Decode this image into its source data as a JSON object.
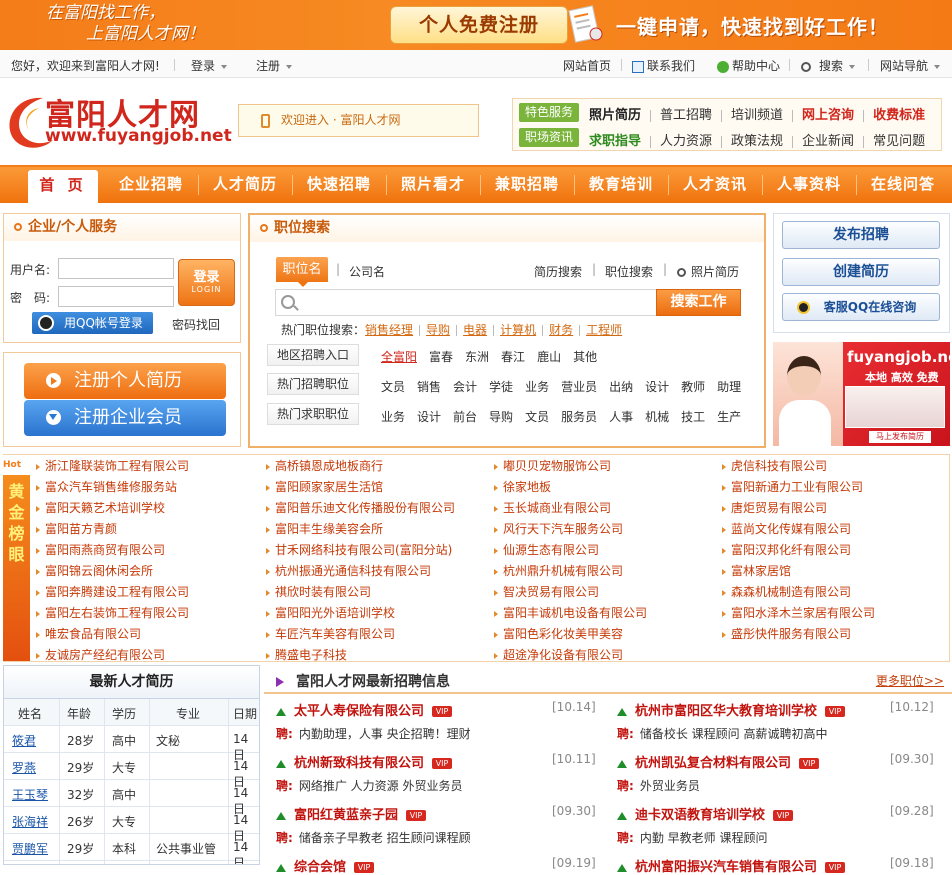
{
  "banner": {
    "slogan_line1": "在富阳找工作，",
    "slogan_line2": "上富阳人才网！",
    "register_label": "个人免费注册",
    "apply_text": "一键申请，快速找到好工作！"
  },
  "topbar": {
    "greeting": "您好，欢迎来到富阳人才网!",
    "login": "登录",
    "register": "注册",
    "site_home": "网站首页",
    "contact": "联系我们",
    "help": "帮助中心",
    "search": "搜索",
    "site_nav": "网站导航"
  },
  "header": {
    "logo_title": "富阳人才网",
    "logo_url": "www.fuyangjob.net",
    "welcome_text": "欢迎进入 · 富阳人才网",
    "quick_tags": [
      "特色服务",
      "职场资讯"
    ],
    "quick_row1": [
      "照片简历",
      "普工招聘",
      "培训频道",
      "网上咨询",
      "收费标准"
    ],
    "quick_row2": [
      "求职指导",
      "人力资源",
      "政策法规",
      "企业新闻",
      "常见问题"
    ]
  },
  "nav": {
    "items": [
      "首 页",
      "企业招聘",
      "人才简历",
      "快速招聘",
      "照片看才",
      "兼职招聘",
      "教育培训",
      "人才资讯",
      "人事资料",
      "在线问答"
    ]
  },
  "login": {
    "title": "企业/个人服务",
    "username_label": "用户名:",
    "password_label": "密　码:",
    "login_button": "登录",
    "login_button_en": "LOGIN",
    "qq_login": "用QQ帐号登录",
    "forgot": "密码找回",
    "register_person": "注册个人简历",
    "register_company": "注册企业会员"
  },
  "search": {
    "title": "职位搜索",
    "tab_active": "职位名",
    "tab_company": "公司名",
    "link_resume": "简历搜索",
    "link_job": "职位搜索",
    "link_photo": "照片简历",
    "input_placeholder": "",
    "button": "搜索工作",
    "hot_label": "热门职位搜索：",
    "hot_keywords": [
      "销售经理",
      "导购",
      "电器",
      "计算机",
      "财务",
      "工程师"
    ],
    "area_label": "地区招聘入口",
    "areas": [
      "全富阳",
      "富春",
      "东洲",
      "春江",
      "鹿山",
      "其他"
    ],
    "hot_jobs_label": "热门招聘职位",
    "hot_jobs": [
      "文员",
      "销售",
      "会计",
      "学徒",
      "业务",
      "营业员",
      "出纳",
      "设计",
      "教师",
      "助理"
    ],
    "hot_seek_label": "热门求职职位",
    "hot_seek": [
      "业务",
      "设计",
      "前台",
      "导购",
      "文员",
      "服务员",
      "人事",
      "机械",
      "技工",
      "生产"
    ]
  },
  "right": {
    "publish": "发布招聘",
    "create_resume": "创建简历",
    "qq_service": "客服QQ在线咨询",
    "ad_url": "fuyangjob.net",
    "ad_slogan": "本地 高效 免费",
    "ad_cta": "马上发布简历"
  },
  "gold": {
    "hot_tag": "Hot",
    "title": "黄金榜眼",
    "col1": [
      "浙江隆联装饰工程有限公司",
      "富众汽车销售维修服务站",
      "富阳天籁艺术培训学校",
      "富阳苗方青颜",
      "富阳雨燕商贸有限公司",
      "富阳锦云阁休闲会所",
      "富阳奔腾建设工程有限公司",
      "富阳左右装饰工程有限公司",
      "唯宏食品有限公司",
      "友诚房产经纪有限公司"
    ],
    "col2": [
      "高桥镇恩成地板商行",
      "富阳顾家家居生活馆",
      "富阳普乐迪文化传播股份有限公司",
      "富阳丰生缘美容会所",
      "甘禾网络科技有限公司(富阳分站)",
      "杭州振通光通信科技有限公司",
      "祺欣时装有限公司",
      "富阳阳光外语培训学校",
      "车匠汽车美容有限公司",
      "腾盛电子科技"
    ],
    "col3": [
      "嘟贝贝宠物服饰公司",
      "徐家地板",
      "玉长城商业有限公司",
      "风行天下汽车服务公司",
      "仙源生态有限公司",
      "杭州鼎升机械有限公司",
      "智决贸易有限公司",
      "富阳丰诚机电设备有限公司",
      "富阳色彩化妆美甲美容",
      "超途净化设备有限公司"
    ],
    "col4": [
      "虎信科技有限公司",
      "富阳新通力工业有限公司",
      "唐炬贸易有限公司",
      "蓝尚文化传媒有限公司",
      "富阳汉邦化纤有限公司",
      "富林家居馆",
      "森森机械制造有限公司",
      "富阳水泽木兰家居有限公司",
      "盛彤快件服务有限公司"
    ]
  },
  "resumes": {
    "title": "最新人才简历",
    "headers": [
      "姓名",
      "年龄",
      "学历",
      "专业",
      "日期"
    ],
    "rows": [
      [
        "筱君",
        "28岁",
        "高中",
        "文秘",
        "14日"
      ],
      [
        "罗燕",
        "29岁",
        "大专",
        "",
        "14日"
      ],
      [
        "王玉琴",
        "32岁",
        "高中",
        "",
        "14日"
      ],
      [
        "张海祥",
        "26岁",
        "大专",
        "",
        "14日"
      ],
      [
        "贾鹏军",
        "29岁",
        "本科",
        "公共事业管",
        "14日"
      ]
    ]
  },
  "jobs": {
    "title": "富阳人才网最新招聘信息",
    "more": "更多职位>>",
    "vip": "VIP",
    "recruit_prefix": "聘:",
    "left": [
      {
        "company": "太平人寿保险有限公司",
        "date": "[10.14]",
        "positions": "内勤助理，人事 央企招聘！理财"
      },
      {
        "company": "杭州新致科技有限公司",
        "date": "[10.11]",
        "positions": "网络推广 人力资源 外贸业务员"
      },
      {
        "company": "富阳红黄蓝亲子园",
        "date": "[09.30]",
        "positions": "储备亲子早教老 招生顾问课程顾"
      },
      {
        "company": "综合会馆",
        "date": "[09.19]",
        "positions": ""
      }
    ],
    "right": [
      {
        "company": "杭州市富阳区华大教育培训学校",
        "date": "[10.12]",
        "positions": "储备校长 课程顾问 高薪诚聘初高中"
      },
      {
        "company": "杭州凯弘复合材料有限公司",
        "date": "[09.30]",
        "positions": "外贸业务员"
      },
      {
        "company": "迪卡双语教育培训学校",
        "date": "[09.28]",
        "positions": "内勤 早教老师 课程顾问"
      },
      {
        "company": "杭州富阳振兴汽车销售有限公司",
        "date": "[09.18]",
        "positions": ""
      }
    ]
  },
  "colors": {
    "accent": "#f47c19",
    "brand_red": "#d0261c",
    "green": "#7ab43a",
    "blue": "#1b4f95"
  }
}
